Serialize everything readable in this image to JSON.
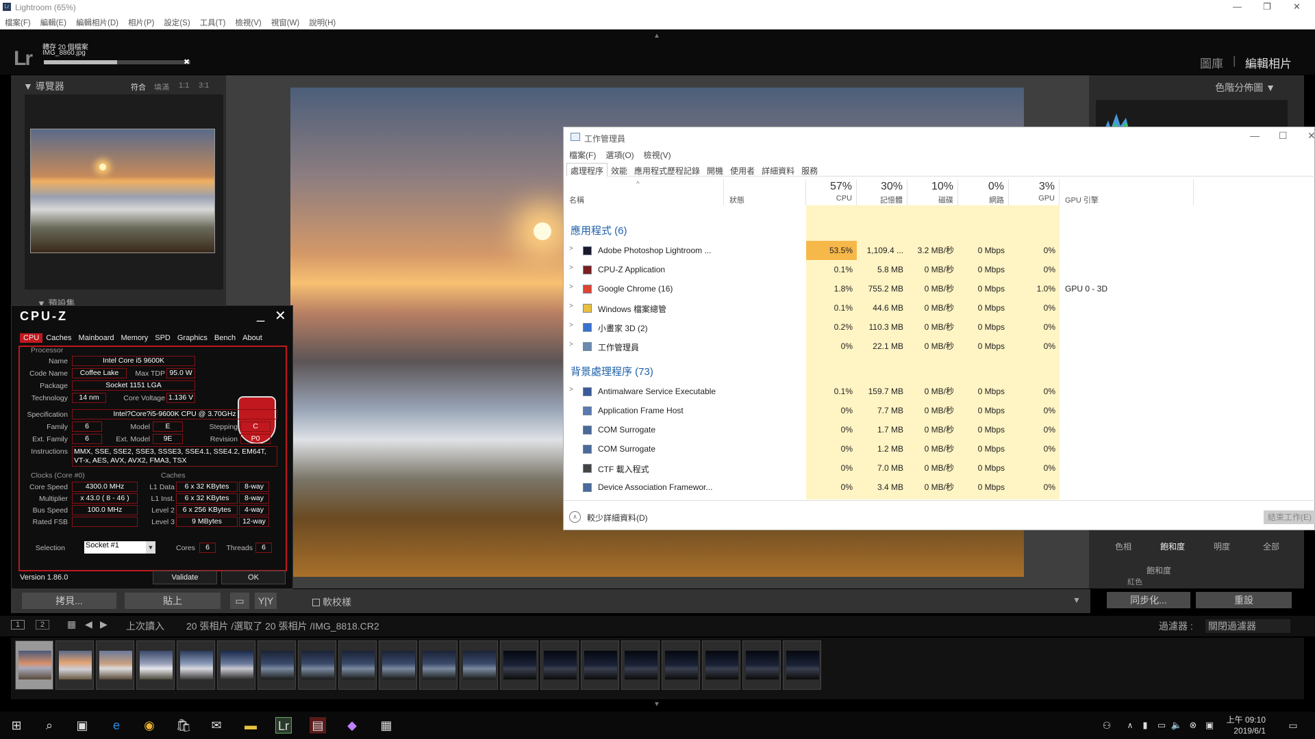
{
  "lightroom": {
    "window_title": "Lightroom (65%)",
    "menu": [
      "檔案(F)",
      "編輯(E)",
      "編輯相片(D)",
      "相片(P)",
      "設定(S)",
      "工具(T)",
      "檢視(V)",
      "視窗(W)",
      "說明(H)"
    ],
    "logo": "Lr",
    "progress": {
      "title": "轉存 20 個檔案",
      "file": "IMG_8860.jpg",
      "fraction": 0.5
    },
    "modules": {
      "library": "圖庫",
      "separator": "|",
      "develop": "編輯相片"
    },
    "navigator": {
      "title": "導覽器",
      "zoom": [
        "符合",
        "填滿",
        "1:1",
        "3:1"
      ]
    },
    "presets_label": "預設集",
    "histogram_title": "色階分佈圖",
    "hsl_tabs": [
      "色相",
      "飽和度",
      "明度",
      "全部"
    ],
    "hsl_section": "飽和度",
    "hsl_red": "紅色",
    "toolbar": {
      "copy": "拷貝...",
      "paste": "貼上",
      "soft_proof": "軟校樣"
    },
    "right_buttons": {
      "sync": "同步化...",
      "reset": "重設"
    },
    "filmstrip_bar": {
      "page1": "1",
      "page2": "2",
      "source": "上次讀入",
      "selection": "20 張相片 /選取了 20 張相片 /IMG_8818.CR2",
      "filter_label": "過濾器 :",
      "filter_value": "關閉過濾器"
    },
    "thumbnail_count": 20
  },
  "cpuz": {
    "title": "CPU-Z",
    "tabs": [
      "CPU",
      "Caches",
      "Mainboard",
      "Memory",
      "SPD",
      "Graphics",
      "Bench",
      "About"
    ],
    "processor_label": "Processor",
    "name_label": "Name",
    "name": "Intel Core i5 9600K",
    "code_name_label": "Code Name",
    "code_name": "Coffee Lake",
    "max_tdp_label": "Max TDP",
    "max_tdp": "95.0 W",
    "package_label": "Package",
    "package": "Socket 1151 LGA",
    "technology_label": "Technology",
    "technology": "14 nm",
    "core_voltage_label": "Core Voltage",
    "core_voltage": "1.136 V",
    "spec_label": "Specification",
    "spec": "Intel?Core?i5-9600K CPU @ 3.70GHz",
    "family_label": "Family",
    "family": "6",
    "model_label": "Model",
    "model": "E",
    "stepping_label": "Stepping",
    "stepping": "C",
    "ext_family_label": "Ext. Family",
    "ext_family": "6",
    "ext_model_label": "Ext. Model",
    "ext_model": "9E",
    "revision_label": "Revision",
    "revision": "P0",
    "instructions_label": "Instructions",
    "instructions": "MMX, SSE, SSE2, SSE3, SSSE3, SSE4.1, SSE4.2, EM64T, VT-x, AES, AVX, AVX2, FMA3, TSX",
    "clocks_title": "Clocks (Core #0)",
    "core_speed_label": "Core Speed",
    "core_speed": "4300.0 MHz",
    "multiplier_label": "Multiplier",
    "multiplier": "x 43.0 ( 8 - 46 )",
    "bus_speed_label": "Bus Speed",
    "bus_speed": "100.0 MHz",
    "rated_fsb_label": "Rated FSB",
    "caches_title": "Caches",
    "l1d_label": "L1 Data",
    "l1d": "6 x 32 KBytes",
    "l1d_way": "8-way",
    "l1i_label": "L1 Inst.",
    "l1i": "6 x 32 KBytes",
    "l1i_way": "8-way",
    "l2_label": "Level 2",
    "l2": "6 x 256 KBytes",
    "l2_way": "4-way",
    "l3_label": "Level 3",
    "l3": "9 MBytes",
    "l3_way": "12-way",
    "selection_label": "Selection",
    "selection": "Socket #1",
    "cores_label": "Cores",
    "cores": "6",
    "threads_label": "Threads",
    "threads": "6",
    "version": "Version 1.86.0",
    "validate": "Validate",
    "ok": "OK"
  },
  "taskmgr": {
    "title": "工作管理員",
    "menu": [
      "檔案(F)",
      "選項(O)",
      "檢視(V)"
    ],
    "tabs": [
      "處理程序",
      "效能",
      "應用程式歷程記錄",
      "開機",
      "使用者",
      "詳細資料",
      "服務"
    ],
    "columns": {
      "name": "名稱",
      "status": "狀態",
      "cpu_pct": "57%",
      "cpu": "CPU",
      "mem_pct": "30%",
      "mem": "記憶體",
      "disk_pct": "10%",
      "disk": "磁碟",
      "net_pct": "0%",
      "net": "網路",
      "gpu_pct": "3%",
      "gpu": "GPU",
      "gpu_engine": "GPU 引擎"
    },
    "apps_group": "應用程式 (6)",
    "bg_group": "背景處理程序 (73)",
    "apps": [
      {
        "name": "Adobe Photoshop Lightroom ...",
        "cpu": "53.5%",
        "mem": "1,109.4 ...",
        "disk": "3.2 MB/秒",
        "net": "0 Mbps",
        "gpu": "0%",
        "engine": ""
      },
      {
        "name": "CPU-Z Application",
        "cpu": "0.1%",
        "mem": "5.8 MB",
        "disk": "0 MB/秒",
        "net": "0 Mbps",
        "gpu": "0%",
        "engine": ""
      },
      {
        "name": "Google Chrome (16)",
        "cpu": "1.8%",
        "mem": "755.2 MB",
        "disk": "0 MB/秒",
        "net": "0 Mbps",
        "gpu": "1.0%",
        "engine": "GPU 0 - 3D"
      },
      {
        "name": "Windows 檔案總管",
        "cpu": "0.1%",
        "mem": "44.6 MB",
        "disk": "0 MB/秒",
        "net": "0 Mbps",
        "gpu": "0%",
        "engine": ""
      },
      {
        "name": "小畫家 3D (2)",
        "cpu": "0.2%",
        "mem": "110.3 MB",
        "disk": "0 MB/秒",
        "net": "0 Mbps",
        "gpu": "0%",
        "engine": ""
      },
      {
        "name": "工作管理員",
        "cpu": "0%",
        "mem": "22.1 MB",
        "disk": "0 MB/秒",
        "net": "0 Mbps",
        "gpu": "0%",
        "engine": ""
      }
    ],
    "background": [
      {
        "name": "Antimalware Service Executable",
        "cpu": "0.1%",
        "mem": "159.7 MB",
        "disk": "0 MB/秒",
        "net": "0 Mbps",
        "gpu": "0%"
      },
      {
        "name": "Application Frame Host",
        "cpu": "0%",
        "mem": "7.7 MB",
        "disk": "0 MB/秒",
        "net": "0 Mbps",
        "gpu": "0%"
      },
      {
        "name": "COM Surrogate",
        "cpu": "0%",
        "mem": "1.7 MB",
        "disk": "0 MB/秒",
        "net": "0 Mbps",
        "gpu": "0%"
      },
      {
        "name": "COM Surrogate",
        "cpu": "0%",
        "mem": "1.2 MB",
        "disk": "0 MB/秒",
        "net": "0 Mbps",
        "gpu": "0%"
      },
      {
        "name": "CTF 載入程式",
        "cpu": "0%",
        "mem": "7.0 MB",
        "disk": "0 MB/秒",
        "net": "0 Mbps",
        "gpu": "0%"
      },
      {
        "name": "Device Association Framewor...",
        "cpu": "0%",
        "mem": "3.4 MB",
        "disk": "0 MB/秒",
        "net": "0 Mbps",
        "gpu": "0%"
      }
    ],
    "fewer_details": "較少詳細資料(D)",
    "end_task": "結束工作(E)"
  },
  "taskbar": {
    "time": "上午 09:10",
    "date": "2019/6/1"
  }
}
